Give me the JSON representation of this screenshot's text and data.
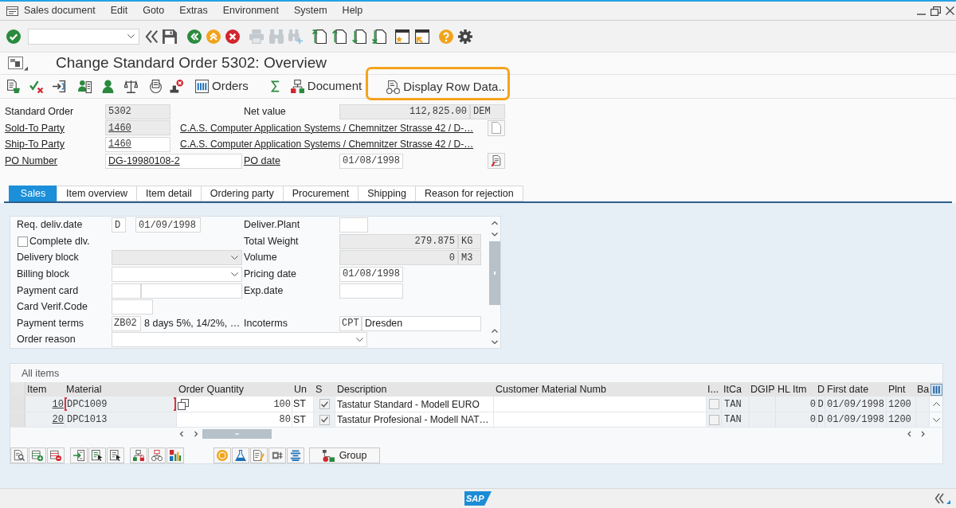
{
  "menu_bar": {
    "items": [
      "Sales document",
      "Edit",
      "Goto",
      "Extras",
      "Environment",
      "System",
      "Help"
    ]
  },
  "title": "Change Standard Order 5302: Overview",
  "app_toolbar": {
    "buttons": [
      {
        "label": "Orders",
        "highlighted": false
      },
      {
        "label": "Document",
        "highlighted": false
      },
      {
        "label": "Display Row Data..",
        "highlighted": true
      }
    ]
  },
  "header": {
    "standard_order": {
      "label": "Standard Order",
      "link": false,
      "value": "5302",
      "disabled": true
    },
    "net_value": {
      "label": "Net value",
      "link": false,
      "value": "112,825.00",
      "currency": "DEM",
      "disabled": true
    },
    "sold_to_party": {
      "label": "Sold-To Party",
      "link": true,
      "value": "1460",
      "disabled": true,
      "description": "C.A.S. Computer Application Systems / Chemnitzer Strasse 42 / D-…"
    },
    "ship_to_party": {
      "label": "Ship-To Party",
      "link": true,
      "value": "1460",
      "disabled": false,
      "description": "C.A.S. Computer Application Systems / Chemnitzer Strasse 42 / D-…"
    },
    "po_number": {
      "label": "PO Number",
      "link": true,
      "value": "DG-19980108-2",
      "disabled": false
    },
    "po_date": {
      "label": "PO date",
      "link": true,
      "value": "01/08/1998",
      "disabled": false
    }
  },
  "tabs": [
    {
      "label": "Sales",
      "selected": true
    },
    {
      "label": "Item overview",
      "selected": false
    },
    {
      "label": "Item detail",
      "selected": false
    },
    {
      "label": "Ordering party",
      "selected": false
    },
    {
      "label": "Procurement",
      "selected": false
    },
    {
      "label": "Shipping",
      "selected": false
    },
    {
      "label": "Reason for rejection",
      "selected": false
    }
  ],
  "sales_tab": {
    "req_deliv_date": {
      "label": "Req. deliv.date",
      "format": "D",
      "value": "01/09/1998"
    },
    "deliver_plant": {
      "label": "Deliver.Plant"
    },
    "complete_dlv": {
      "label": "Complete dlv.",
      "checked": false
    },
    "total_weight": {
      "label": "Total Weight",
      "value": "279.875",
      "unit": "KG",
      "disabled": true
    },
    "delivery_block": {
      "label": "Delivery block",
      "disabled": true
    },
    "volume": {
      "label": "Volume",
      "value": "0",
      "unit": "M3",
      "disabled": true
    },
    "billing_block": {
      "label": "Billing block",
      "disabled": false
    },
    "pricing_date": {
      "label": "Pricing date",
      "value": "01/08/1998"
    },
    "payment_card": {
      "label": "Payment card"
    },
    "exp_date": {
      "label": "Exp.date"
    },
    "card_verif_code": {
      "label": "Card Verif.Code"
    },
    "payment_terms": {
      "label": "Payment terms",
      "code": "ZB02",
      "text": "8 days 5%, 14/2%, …"
    },
    "incoterms": {
      "label": "Incoterms",
      "code": "CPT",
      "place": "Dresden"
    },
    "order_reason": {
      "label": "Order reason"
    }
  },
  "items": {
    "title": "All items",
    "columns": [
      "Item",
      "Material",
      "Order Quantity",
      "Un",
      "S",
      "Description",
      "Customer Material Numb",
      "I...",
      "ItCa",
      "DGIP",
      "HL Itm",
      "D",
      "First date",
      "Plnt",
      "Ba"
    ],
    "rows": [
      {
        "item": "10",
        "material": "DPC1009",
        "focused": true,
        "order_quantity": "100",
        "unit": "ST",
        "s_checked": true,
        "description": "Tastatur Standard - Modell EURO",
        "i_checked": false,
        "item_category": "TAN",
        "hl_item": "0",
        "d": "D",
        "first_date": "01/09/1998",
        "plant": "1200"
      },
      {
        "item": "20",
        "material": "DPC1013",
        "focused": false,
        "order_quantity": "80",
        "unit": "ST",
        "s_checked": true,
        "description": "Tastatur Profesional - Modell NAT…",
        "i_checked": false,
        "item_category": "TAN",
        "hl_item": "0",
        "d": "D",
        "first_date": "01/09/1998",
        "plant": "1200"
      }
    ]
  },
  "item_toolbar": {
    "buttons": [
      "Group"
    ]
  },
  "status_bar": {
    "logo": "SAP"
  }
}
